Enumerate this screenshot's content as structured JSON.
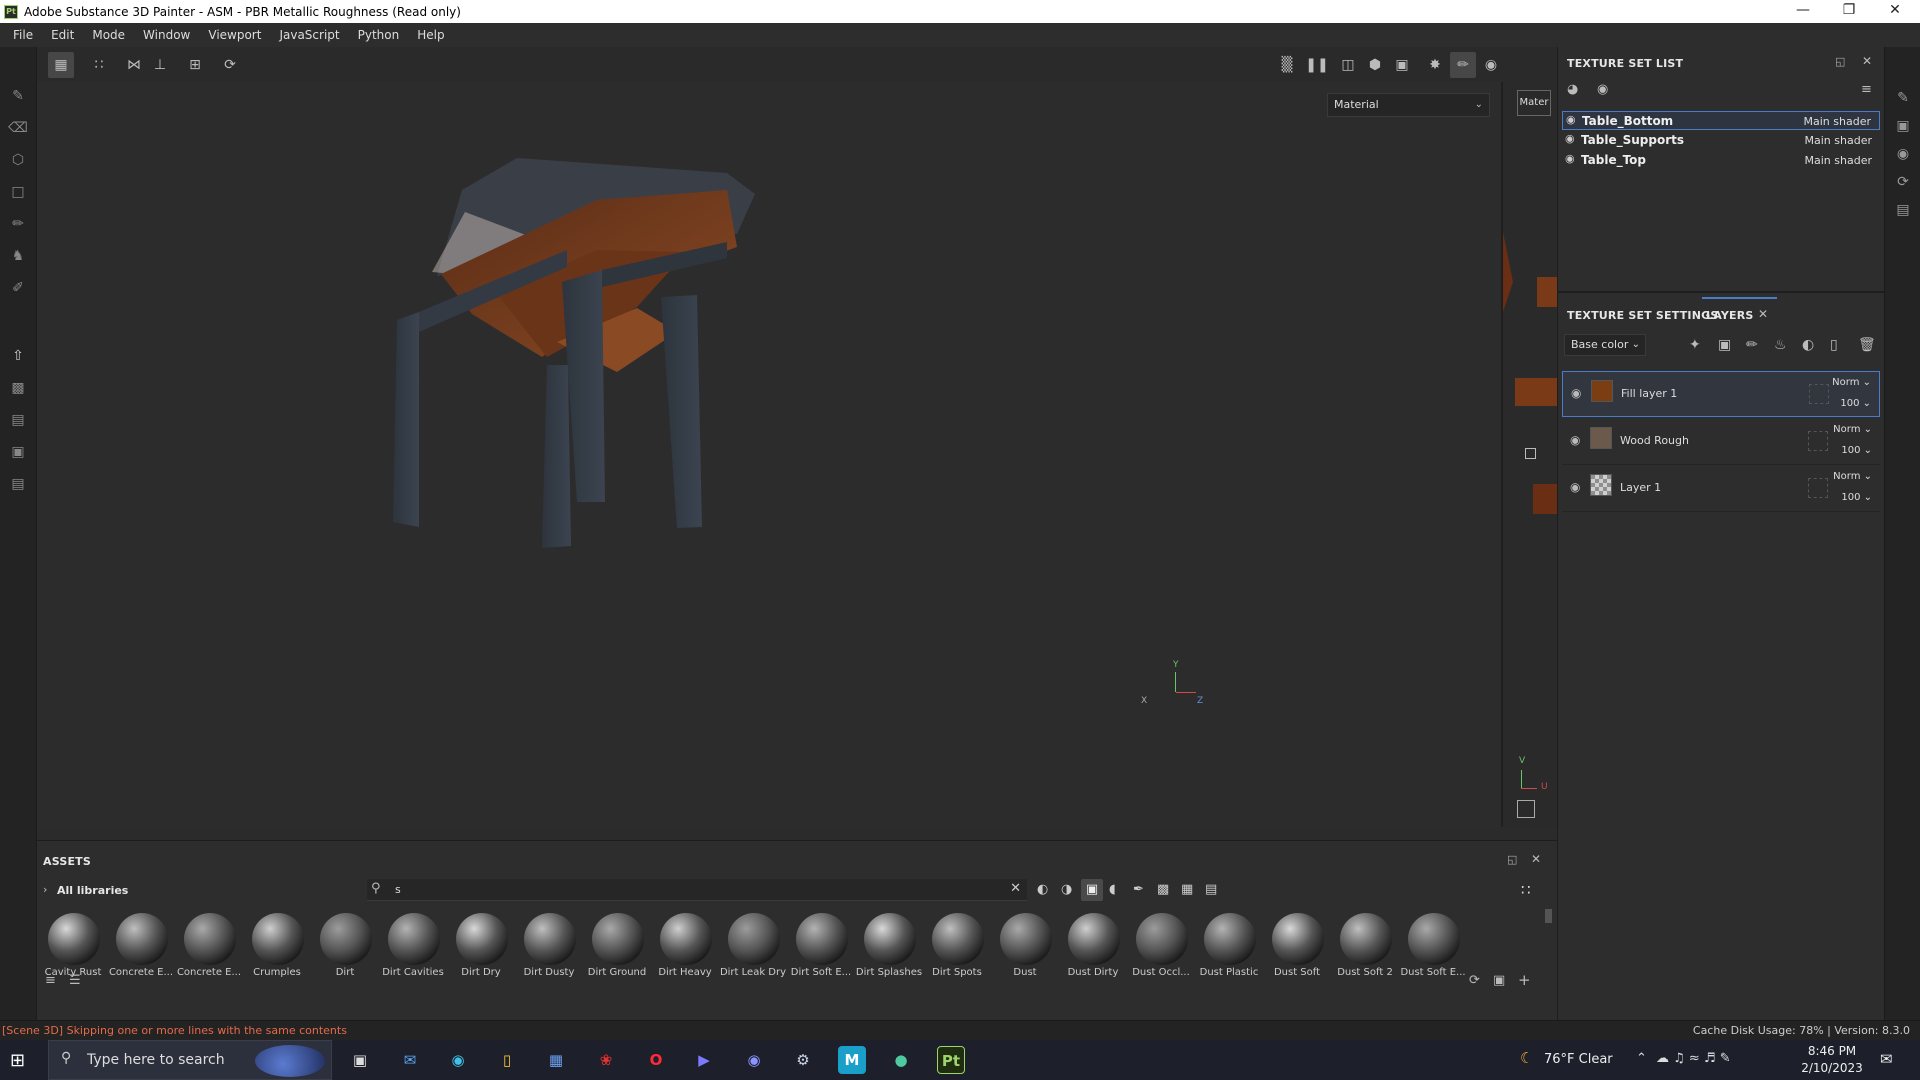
{
  "window": {
    "title": "Adobe Substance 3D Painter - ASM - PBR Metallic Roughness (Read only)",
    "app_icon": "Pt",
    "controls": [
      "minimize-icon",
      "maximize-icon",
      "close-icon"
    ]
  },
  "menu": [
    "File",
    "Edit",
    "Mode",
    "Window",
    "Viewport",
    "JavaScript",
    "Python",
    "Help"
  ],
  "viewport": {
    "material_mode": "Material",
    "uv_material_label": "Mater",
    "axis_labels": {
      "y": "Y",
      "x": "X",
      "z": "Z",
      "v": "V",
      "u": "U"
    }
  },
  "texture_set_list": {
    "title": "TEXTURE SET LIST",
    "items": [
      {
        "name": "Table_Bottom",
        "shader": "Main shader",
        "selected": true
      },
      {
        "name": "Table_Supports",
        "shader": "Main shader",
        "selected": false
      },
      {
        "name": "Table_Top",
        "shader": "Main shader",
        "selected": false
      }
    ]
  },
  "layers_panel": {
    "tab_settings": "TEXTURE SET SETTINGS",
    "tab_layers": "LAYERS",
    "channel": "Base color",
    "layers": [
      {
        "name": "Fill layer 1",
        "blend": "Norm",
        "opacity": "100",
        "selected": true,
        "thumb_color": "#7a3e12"
      },
      {
        "name": "Wood Rough",
        "blend": "Norm",
        "opacity": "100",
        "selected": false,
        "thumb_color": "#6b5a4c"
      },
      {
        "name": "Layer 1",
        "blend": "Norm",
        "opacity": "100",
        "selected": false,
        "thumb_color": "#cfcfcf"
      }
    ]
  },
  "assets": {
    "title": "ASSETS",
    "library": "All libraries",
    "search_value": "s",
    "items": [
      "Cavity Rust",
      "Concrete E...",
      "Concrete E...",
      "Crumples",
      "Dirt",
      "Dirt Cavities",
      "Dirt Dry",
      "Dirt Dusty",
      "Dirt Ground",
      "Dirt Heavy",
      "Dirt Leak Dry",
      "Dirt Soft E...",
      "Dirt Splashes",
      "Dirt Spots",
      "Dust",
      "Dust Dirty",
      "Dust Occl...",
      "Dust Plastic",
      "Dust Soft",
      "Dust Soft 2",
      "Dust Soft E..."
    ]
  },
  "status": {
    "error": "[Scene 3D] Skipping one or more lines with the same contents",
    "cache": "Cache Disk Usage:   78% | Version: 8.3.0"
  },
  "taskbar": {
    "search_placeholder": "Type here to search",
    "weather": "76°F  Clear",
    "time": "8:46 PM",
    "date": "2/10/2023"
  },
  "colors": {
    "accent": "#4a7cc9",
    "error": "#e46a4a",
    "wood": "#7a3e1c"
  }
}
